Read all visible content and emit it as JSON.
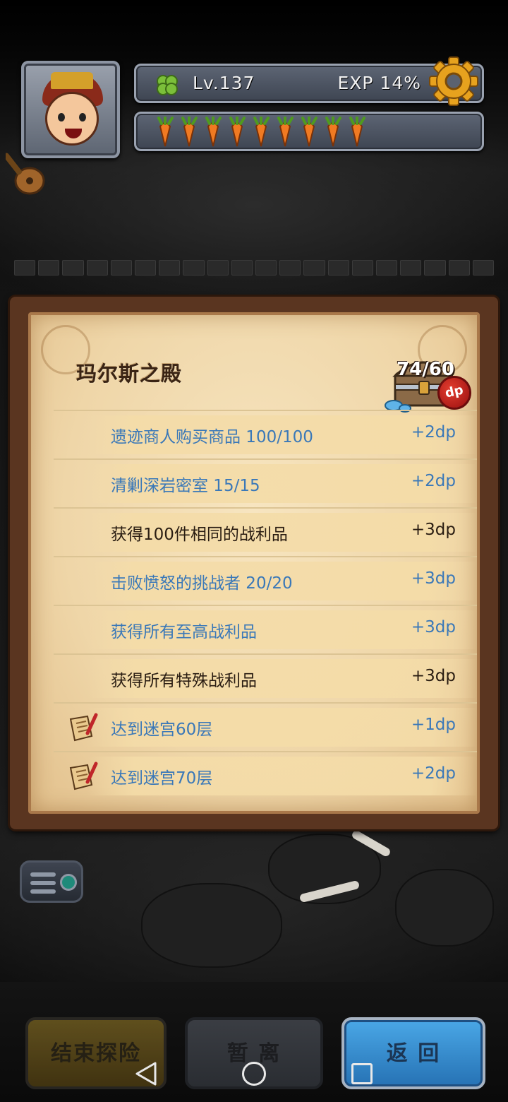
{
  "hud": {
    "level": "Lv.137",
    "exp": "EXP 14%",
    "carrot_count": 9,
    "icons": [
      "level-clover-icon",
      "gear-icon",
      "carrot-icon"
    ]
  },
  "panel": {
    "title": "玛尔斯之殿",
    "dp_count": "74/60",
    "dp_badge": "dp",
    "items": [
      {
        "label": "遗迹商人购买商品 100/100",
        "reward": "+2dp",
        "status": "done",
        "icon": null
      },
      {
        "label": "清剿深岩密室 15/15",
        "reward": "+2dp",
        "status": "done",
        "icon": null
      },
      {
        "label": "获得100件相同的战利品",
        "reward": "+3dp",
        "status": "todo",
        "icon": null
      },
      {
        "label": "击败愤怒的挑战者 20/20",
        "reward": "+3dp",
        "status": "done",
        "icon": null
      },
      {
        "label": "获得所有至高战利品",
        "reward": "+3dp",
        "status": "done",
        "icon": null
      },
      {
        "label": "获得所有特殊战利品",
        "reward": "+3dp",
        "status": "todo",
        "icon": null
      },
      {
        "label": "达到迷宫60层",
        "reward": "+1dp",
        "status": "done",
        "icon": "scroll-quill-icon"
      },
      {
        "label": "达到迷宫70层",
        "reward": "+2dp",
        "status": "done",
        "icon": "scroll-quill-icon"
      }
    ]
  },
  "buttons": {
    "end_label": "结束探险",
    "pause_label": "暂 离",
    "back_label": "返 回"
  },
  "colors": {
    "done_text": "#3a78b8",
    "todo_text": "#2a1d12",
    "back_button": "#3b8fd2"
  }
}
